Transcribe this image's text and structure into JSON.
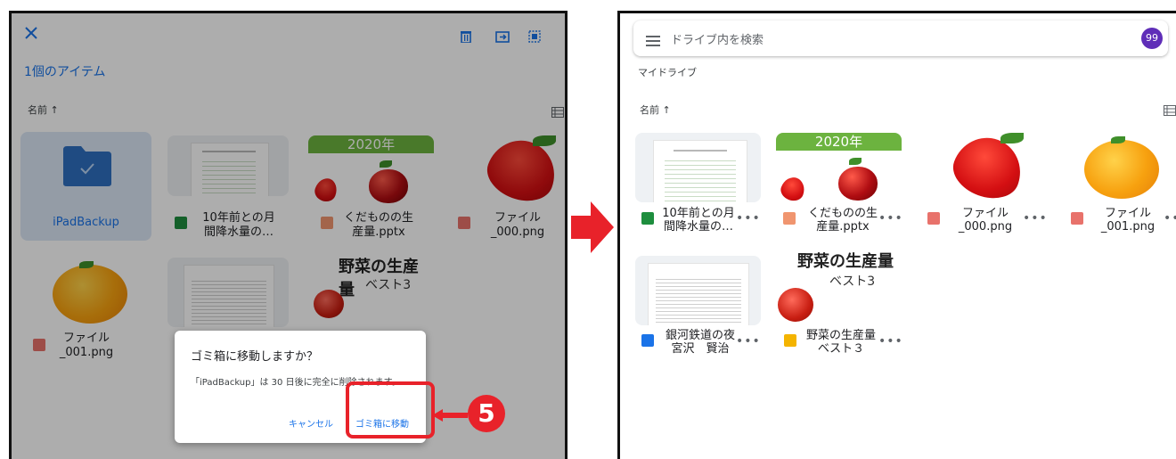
{
  "left": {
    "item_count": "1個のアイテム",
    "sort_label": "名前 ↑",
    "folder_name": "iPadBackup",
    "files": [
      {
        "line1": "10年前との月",
        "line2": "間降水量の…"
      },
      {
        "line1": "くだものの生",
        "line2": "産量.pptx"
      },
      {
        "line1": "ファイル",
        "line2": "_000.png"
      },
      {
        "line1": "ファイル",
        "line2": "_001.png"
      }
    ],
    "banner_2020": "2020年",
    "veg_title": "野菜の生産量",
    "veg_sub": "ベスト3",
    "dialog": {
      "title": "ゴミ箱に移動しますか？",
      "message": "「iPadBackup」は 30 日後に完全に削除されます。",
      "cancel": "キャンセル",
      "confirm": "ゴミ箱に移動"
    },
    "step_number": "5"
  },
  "right": {
    "search_placeholder": "ドライブ内を検索",
    "avatar": "99",
    "breadcrumb": "マイドライブ",
    "sort_label": "名前 ↑",
    "banner_2020": "2020年",
    "veg_title": "野菜の生産量",
    "veg_sub": "ベスト3",
    "files": [
      {
        "line1": "10年前との月",
        "line2": "間降水量の…"
      },
      {
        "line1": "くだものの生",
        "line2": "産量.pptx"
      },
      {
        "line1": "ファイル",
        "line2": "_000.png"
      },
      {
        "line1": "ファイル",
        "line2": "_001.png"
      },
      {
        "line1": "銀河鉄道の夜",
        "line2": "宮沢　賢治"
      },
      {
        "line1": "野菜の生産量",
        "line2": "ベスト３"
      }
    ],
    "more": "•••"
  },
  "colors": {
    "accent": "#1a73e8",
    "highlight": "#e8222a",
    "avatar": "#5f2eb8"
  }
}
